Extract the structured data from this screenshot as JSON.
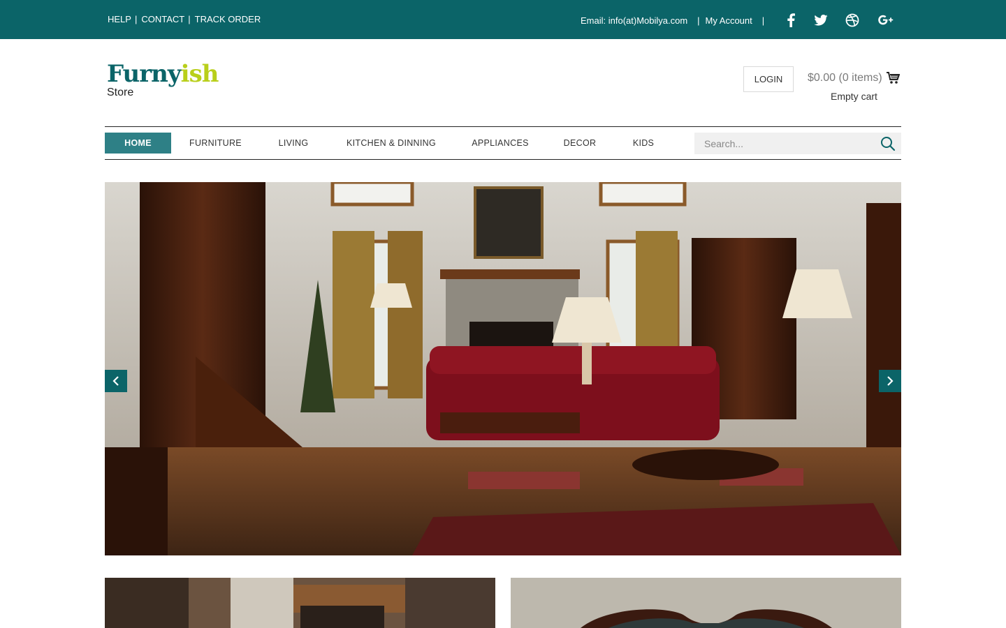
{
  "topbar": {
    "links": [
      "HELP",
      "CONTACT",
      "TRACK ORDER"
    ],
    "email": "Email: info(at)Mobilya.com",
    "account": "My Account",
    "social": [
      "facebook-icon",
      "twitter-icon",
      "dribbble-icon",
      "google-plus-icon"
    ]
  },
  "logo": {
    "part1": "Furny",
    "part2": "ish",
    "sub": "Store"
  },
  "header": {
    "login": "LOGIN",
    "cart_summary": "$0.00 (0 items)",
    "cart_status": "Empty cart"
  },
  "nav": {
    "items": [
      "HOME",
      "FURNITURE",
      "LIVING",
      "KITCHEN & DINNING",
      "APPLIANCES",
      "DECOR",
      "KIDS"
    ],
    "active": "HOME",
    "search_placeholder": "Search..."
  },
  "colors": {
    "brand_teal": "#0b6468",
    "nav_active": "#2e8086",
    "logo_lime": "#b9cf1b"
  }
}
